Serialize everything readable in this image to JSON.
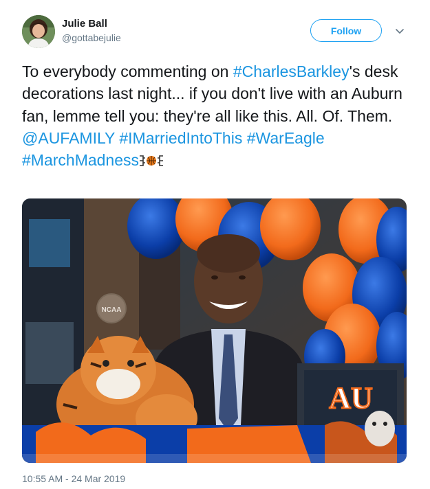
{
  "user": {
    "name": "Julie Ball",
    "handle": "@gottabejulie"
  },
  "follow_label": "Follow",
  "tweet": {
    "parts": [
      {
        "text": "To everybody commenting on "
      },
      {
        "text": "#CharlesBarkley",
        "link": true
      },
      {
        "text": "'s desk decorations last night... if you don't live with an Auburn fan, lemme tell you: they're all like this. All. Of. Them. "
      },
      {
        "text": "@AUFAMILY",
        "link": true
      },
      {
        "text": " "
      },
      {
        "text": "#IMarriedIntoThis",
        "link": true
      },
      {
        "text": " "
      },
      {
        "text": "#WarEagle",
        "link": true
      },
      {
        "text": " "
      },
      {
        "text": "#MarchMadness",
        "link": true
      }
    ],
    "emoji": "basketball-bracket-emoji"
  },
  "photo": {
    "logo_text": "AU",
    "ncaa_text": "NCAA"
  },
  "timestamp": "10:55 AM - 24 Mar 2019",
  "colors": {
    "link": "#1b95e0",
    "follow_border": "#1da1f2",
    "secondary_text": "#657786",
    "auburn_orange": "#f26a1b",
    "auburn_blue": "#0b3ea8"
  }
}
